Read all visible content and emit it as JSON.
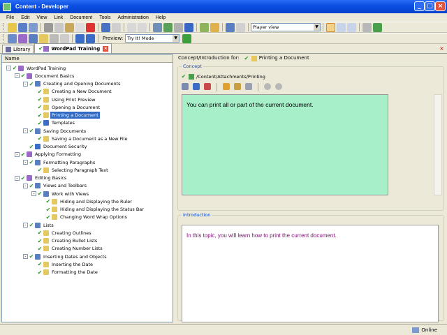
{
  "window": {
    "title": "Content - Developer",
    "minimize": "_",
    "maximize": "□",
    "close": "×"
  },
  "menu": [
    "File",
    "Edit",
    "View",
    "Link",
    "Document",
    "Tools",
    "Administration",
    "Help"
  ],
  "toolbar": {
    "view_select": "Player view"
  },
  "toolbar2": {
    "preview_label": "Preview:",
    "preview_mode": "Try It! Mode"
  },
  "tabs": [
    {
      "label": "Library"
    },
    {
      "label": "WordPad Training"
    }
  ],
  "tree": {
    "header": "Name",
    "items": [
      {
        "label": "WordPad Training",
        "level": 0,
        "expander": "-",
        "icon": "book",
        "selected": false
      },
      {
        "label": "Document Basics",
        "level": 1,
        "expander": "-",
        "icon": "book",
        "selected": false
      },
      {
        "label": "Creating and Opening Documents",
        "level": 2,
        "expander": "-",
        "icon": "module",
        "selected": false
      },
      {
        "label": "Creating a New Document",
        "level": 3,
        "expander": "",
        "icon": "topic",
        "selected": false
      },
      {
        "label": "Using Print Preview",
        "level": 3,
        "expander": "",
        "icon": "topic",
        "selected": false
      },
      {
        "label": "Opening a Document",
        "level": 3,
        "expander": "",
        "icon": "topic",
        "selected": false
      },
      {
        "label": "Printing a Document",
        "level": 3,
        "expander": "",
        "icon": "topic",
        "selected": true
      },
      {
        "label": "Templates",
        "level": 3,
        "expander": "",
        "icon": "doc",
        "selected": false
      },
      {
        "label": "Saving Documents",
        "level": 2,
        "expander": "-",
        "icon": "module",
        "selected": false
      },
      {
        "label": "Saving a Document as a New File",
        "level": 3,
        "expander": "",
        "icon": "topic",
        "selected": false
      },
      {
        "label": "Document Security",
        "level": 2,
        "expander": "",
        "icon": "doc",
        "selected": false
      },
      {
        "label": "Applying Formatting",
        "level": 1,
        "expander": "-",
        "icon": "book",
        "selected": false
      },
      {
        "label": "Formatting Paragraphs",
        "level": 2,
        "expander": "-",
        "icon": "module",
        "selected": false
      },
      {
        "label": "Selecting Paragraph Text",
        "level": 3,
        "expander": "",
        "icon": "topic",
        "selected": false
      },
      {
        "label": "Editing Basics",
        "level": 1,
        "expander": "-",
        "icon": "book",
        "selected": false
      },
      {
        "label": "Views and Toolbars",
        "level": 2,
        "expander": "-",
        "icon": "module",
        "selected": false
      },
      {
        "label": "Work with Views",
        "level": 3,
        "expander": "-",
        "icon": "module",
        "selected": false
      },
      {
        "label": "Hiding and Displaying the Ruler",
        "level": 4,
        "expander": "",
        "icon": "topic",
        "selected": false
      },
      {
        "label": "Hiding and Displaying the Status Bar",
        "level": 4,
        "expander": "",
        "icon": "topic",
        "selected": false
      },
      {
        "label": "Changing Word Wrap Options",
        "level": 4,
        "expander": "",
        "icon": "topic",
        "selected": false
      },
      {
        "label": "Lists",
        "level": 2,
        "expander": "-",
        "icon": "module",
        "selected": false
      },
      {
        "label": "Creating Outlines",
        "level": 3,
        "expander": "",
        "icon": "topic",
        "selected": false
      },
      {
        "label": "Creating Bullet Lists",
        "level": 3,
        "expander": "",
        "icon": "topic",
        "selected": false
      },
      {
        "label": "Creating Number Lists",
        "level": 3,
        "expander": "",
        "icon": "topic",
        "selected": false
      },
      {
        "label": "Inserting Dates and Objects",
        "level": 2,
        "expander": "-",
        "icon": "module",
        "selected": false
      },
      {
        "label": "Inserting the Date",
        "level": 3,
        "expander": "",
        "icon": "topic",
        "selected": false
      },
      {
        "label": "Formatting the Date",
        "level": 3,
        "expander": "",
        "icon": "topic",
        "selected": false
      }
    ]
  },
  "concept": {
    "header_prefix": "Concept/Introduction for:",
    "header_topic": "Printing a Document",
    "group_title": "Concept",
    "path": "/Content/Attachments/Printing",
    "text": "You can print all or part of the current document."
  },
  "introduction": {
    "group_title": "Introduction",
    "text": "In this topic, you will learn how to print the current document."
  },
  "status": {
    "text": "Online"
  },
  "colors": {
    "check": "#2f9c2f",
    "selection": "#316ac5",
    "concept_bg": "#a6efc8",
    "intro_text": "#7a0f6e"
  }
}
